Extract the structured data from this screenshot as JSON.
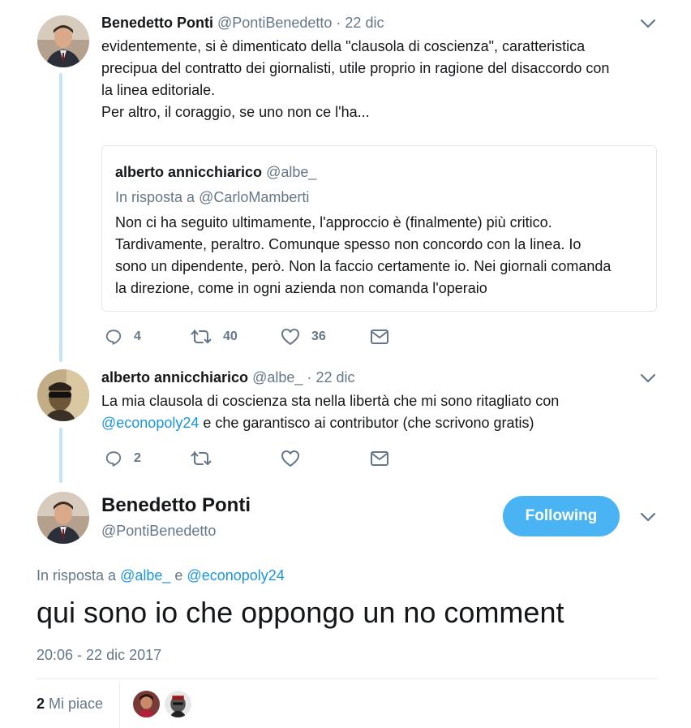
{
  "tweet1": {
    "name": "Benedetto Ponti",
    "handle": "@PontiBenedetto",
    "sep": "·",
    "date": "22 dic",
    "lines": [
      "evidentemente, si è dimenticato della \"clausola di coscienza\", caratteristica",
      "precipua del contratto dei giornalisti, utile proprio in ragione del disaccordo con",
      "la linea editoriale.",
      "Per altro, il coraggio, se uno non ce l'ha..."
    ],
    "quoted": {
      "name": "alberto annicchiarico",
      "handle": "@albe_",
      "reply_prefix": "In risposta a",
      "reply_to": "@CarloMamberti",
      "lines": [
        "Non ci ha seguito ultimamente, l'approccio è (finalmente) più critico.",
        "Tardivamente, peraltro. Comunque spesso non concordo con la linea. Io",
        "sono un dipendente, però. Non la faccio certamente io. Nei giornali comanda",
        "la direzione, come in ogni azienda non comanda l'operaio"
      ]
    },
    "stats": {
      "replies": "4",
      "retweets": "40",
      "likes": "36"
    }
  },
  "tweet2": {
    "name": "alberto annicchiarico",
    "handle": "@albe_",
    "sep": "·",
    "date": "22 dic",
    "line1": "La mia clausola di coscienza sta nella libertà che mi sono ritagliato con",
    "mention": "@econopoly24",
    "line2_rest": " e che garantisco ai contributor (che scrivono gratis)",
    "stats": {
      "replies": "2"
    }
  },
  "main": {
    "name": "Benedetto Ponti",
    "handle": "@PontiBenedetto",
    "follow_label": "Following",
    "reply_prefix": "In risposta a",
    "reply_user1": "@albe_",
    "reply_and": " e ",
    "reply_user2": "@econopoly24",
    "text": "qui sono io che oppongo un no comment",
    "timestamp": "20:06 - 22 dic 2017",
    "likes_count": "2",
    "likes_label": " Mi piace"
  },
  "colors": {
    "accent": "#1b95e0",
    "button": "#4ab3f4",
    "thread": "#c4e3f8",
    "muted": "#657786"
  }
}
